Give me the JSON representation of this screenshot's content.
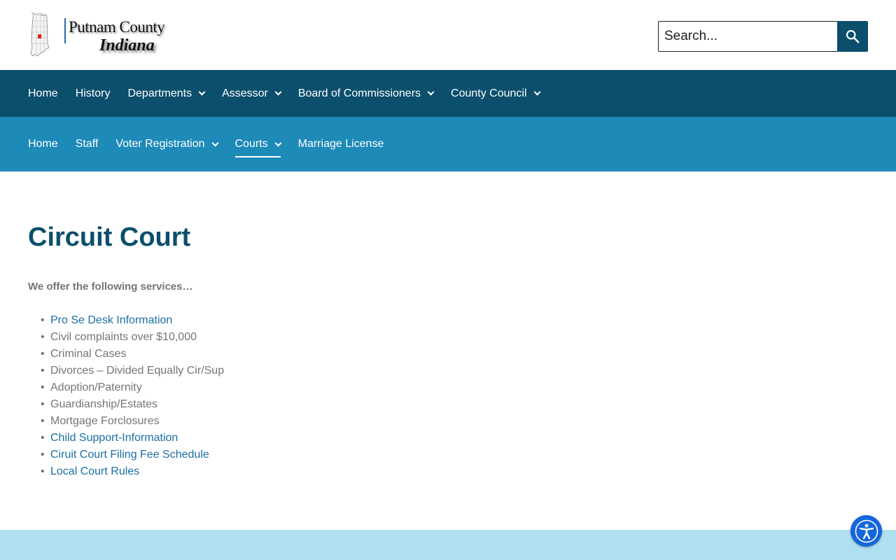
{
  "logo": {
    "line1": "Putnam County",
    "line2": "Indiana"
  },
  "search": {
    "placeholder": "Search..."
  },
  "nav_primary": [
    {
      "label": "Home",
      "dropdown": false
    },
    {
      "label": "History",
      "dropdown": false
    },
    {
      "label": "Departments",
      "dropdown": true
    },
    {
      "label": "Assessor",
      "dropdown": true
    },
    {
      "label": "Board of Commissioners",
      "dropdown": true
    },
    {
      "label": "County Council",
      "dropdown": true
    }
  ],
  "nav_secondary": [
    {
      "label": "Home",
      "dropdown": false
    },
    {
      "label": "Staff",
      "dropdown": false
    },
    {
      "label": "Voter Registration",
      "dropdown": true
    },
    {
      "label": "Courts",
      "dropdown": true,
      "active": true
    },
    {
      "label": "Marriage License",
      "dropdown": false
    }
  ],
  "main": {
    "title": "Circuit Court",
    "intro": "We offer the following services…",
    "services": [
      {
        "text": "Pro Se Desk Information",
        "link": true
      },
      {
        "text": "Civil complaints over $10,000",
        "link": false
      },
      {
        "text": "Criminal Cases",
        "link": false
      },
      {
        "text": "Divorces – Divided Equally Cir/Sup",
        "link": false
      },
      {
        "text": "Adoption/Paternity",
        "link": false
      },
      {
        "text": "Guardianship/Estates",
        "link": false
      },
      {
        "text": "Mortgage Forclosures",
        "link": false
      },
      {
        "text": "Child Support-Information",
        "link": true
      },
      {
        "text": "Ciruit Court Filing Fee Schedule",
        "link": true
      },
      {
        "text": "Local Court Rules",
        "link": true
      }
    ]
  },
  "colors": {
    "nav_primary_bg": "#0b4f6c",
    "nav_secondary_bg": "#1d8ab8",
    "title": "#0b4f6c",
    "link": "#1a6fa6",
    "footer_bg": "#aee0f2",
    "accessibility_button": "#1466dc"
  },
  "icons": {
    "search": "search-icon",
    "accessibility": "accessibility-icon",
    "dropdown": "chevron-down-icon"
  }
}
